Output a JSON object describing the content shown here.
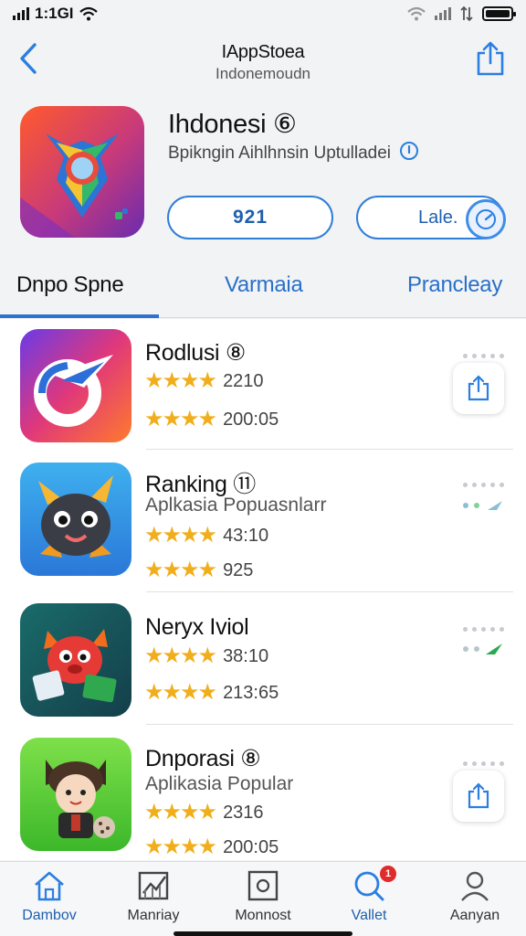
{
  "status": {
    "time": "1:1GI"
  },
  "nav": {
    "title": "IAppStoea",
    "subtitle": "Indonemoudn"
  },
  "featured": {
    "name": "Ihdonesi ⑥",
    "description": "Bpikngin Aihlhnsin Uptulladei",
    "get_label": "921",
    "later_label": "Lale."
  },
  "tabs": [
    "Dnpo Spne",
    "Varmaia",
    "Prancleay"
  ],
  "apps": [
    {
      "title": "Rodlusi ⑧",
      "subtitle": "",
      "rating1": "2210",
      "rating2": "200:05",
      "action": "share"
    },
    {
      "title": "Ranking ⑪",
      "subtitle": "Aplkasia Popuasnlarr",
      "rating1": "43:10",
      "rating2": "925",
      "action": "mini"
    },
    {
      "title": "Neryx Iviol",
      "subtitle": "",
      "rating1": "38:10",
      "rating2": "213:65",
      "action": "mini"
    },
    {
      "title": "Dnporasi ⑧",
      "subtitle": "Aplikasia Popular",
      "rating1": "2316",
      "rating2": "200:05",
      "action": "share"
    }
  ],
  "tabbar": [
    {
      "label": "Dambov",
      "icon": "home-icon",
      "badge": ""
    },
    {
      "label": "Manriay",
      "icon": "chart-icon",
      "badge": ""
    },
    {
      "label": "Monnost",
      "icon": "frame-icon",
      "badge": ""
    },
    {
      "label": "Vallet",
      "icon": "search-icon",
      "badge": "1"
    },
    {
      "label": "Aanyan",
      "icon": "person-icon",
      "badge": ""
    }
  ],
  "colors": {
    "accent": "#2f7ed8",
    "star": "#f1ae1c",
    "badge": "#e02b2b"
  }
}
